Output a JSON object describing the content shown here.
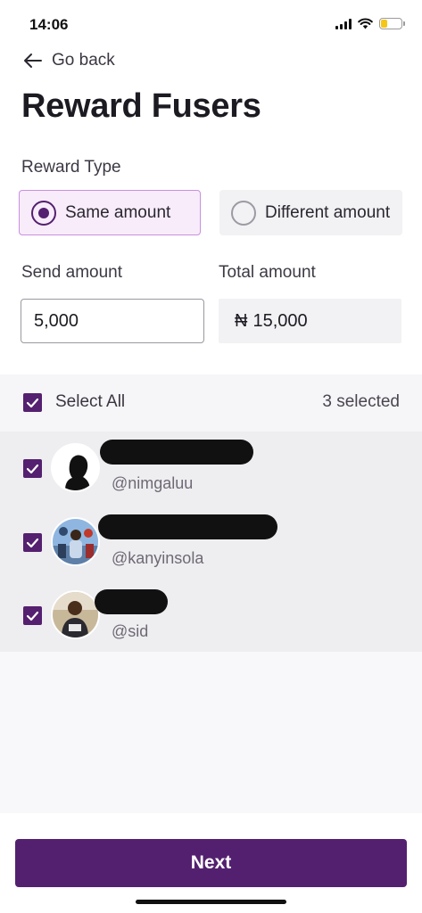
{
  "status_bar": {
    "time": "14:06",
    "icons": [
      "cellular-signal-icon",
      "wifi-icon",
      "battery-icon"
    ],
    "battery_color": "#f5c518"
  },
  "nav": {
    "back_icon": "arrow-left-icon",
    "back_label": "Go back"
  },
  "page_title": "Reward Fusers",
  "reward_type": {
    "label": "Reward Type",
    "options": [
      {
        "label": "Same amount",
        "selected": true
      },
      {
        "label": "Different amount",
        "selected": false
      }
    ]
  },
  "amounts": {
    "send_label": "Send amount",
    "send_value": "5,000",
    "total_label": "Total amount",
    "currency_symbol": "₦",
    "total_value": "15,000"
  },
  "selection": {
    "select_all_label": "Select All",
    "select_all_checked": true,
    "selected_count": "3 selected"
  },
  "users": [
    {
      "handle": "@nimgaluu",
      "checked": true,
      "name_redacted": true
    },
    {
      "handle": "@kanyinsola",
      "checked": true,
      "name_redacted": true
    },
    {
      "handle": "@sid",
      "checked": true,
      "name_redacted": true
    }
  ],
  "footer": {
    "next_label": "Next"
  },
  "colors": {
    "primary": "#54206f",
    "selected_option_bg": "#f8ecfb",
    "selected_option_border": "#c98fe0",
    "muted_bg": "#f2f2f4"
  }
}
